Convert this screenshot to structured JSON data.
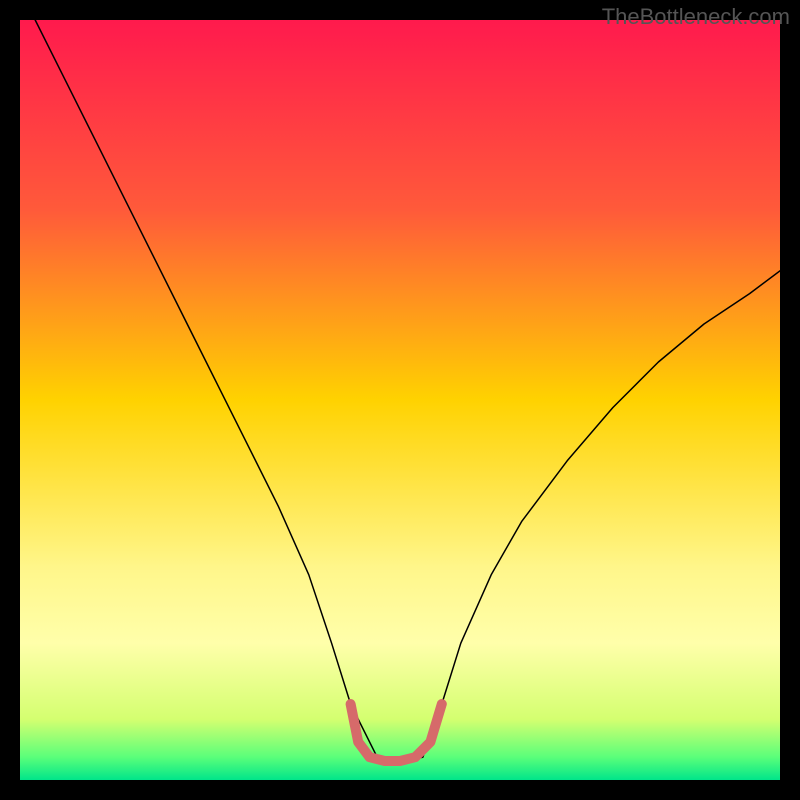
{
  "watermark": "TheBottleneck.com",
  "chart_data": {
    "type": "line",
    "title": "",
    "xlabel": "",
    "ylabel": "",
    "xlim": [
      0,
      100
    ],
    "ylim": [
      0,
      100
    ],
    "background": {
      "type": "vertical-gradient",
      "stops": [
        {
          "offset": 0,
          "color": "#ff1a4d"
        },
        {
          "offset": 0.25,
          "color": "#ff5a3a"
        },
        {
          "offset": 0.5,
          "color": "#ffd200"
        },
        {
          "offset": 0.72,
          "color": "#fff68a"
        },
        {
          "offset": 0.82,
          "color": "#ffffaa"
        },
        {
          "offset": 0.92,
          "color": "#d4ff70"
        },
        {
          "offset": 0.97,
          "color": "#5aff7a"
        },
        {
          "offset": 1.0,
          "color": "#00e58a"
        }
      ]
    },
    "series": [
      {
        "name": "bottleneck-curve",
        "color": "#000000",
        "width": 1.5,
        "x": [
          2,
          6,
          10,
          14,
          18,
          22,
          26,
          30,
          34,
          38,
          41,
          43.5,
          47,
          50,
          53,
          55.5,
          58,
          62,
          66,
          72,
          78,
          84,
          90,
          96,
          100
        ],
        "y": [
          100,
          92,
          84,
          76,
          68,
          60,
          52,
          44,
          36,
          27,
          18,
          10,
          3,
          2.5,
          3,
          10,
          18,
          27,
          34,
          42,
          49,
          55,
          60,
          64,
          67
        ]
      },
      {
        "name": "minimum-highlight",
        "color": "#d66a6a",
        "width": 10,
        "x": [
          43.5,
          44.5,
          46,
          48,
          50,
          52,
          54,
          55.5
        ],
        "y": [
          10,
          5,
          3,
          2.5,
          2.5,
          3,
          5,
          10
        ]
      }
    ]
  }
}
